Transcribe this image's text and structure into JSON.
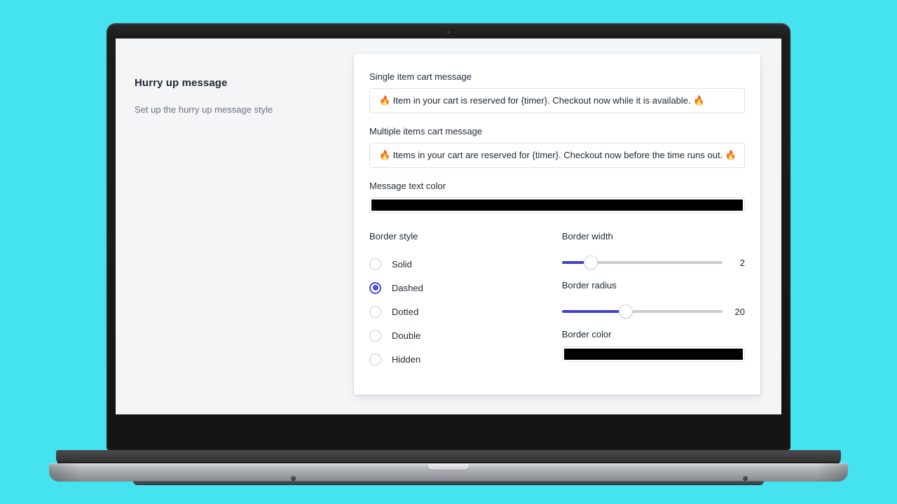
{
  "background_color": "#45e2f0",
  "panel": {
    "title": "Hurry up message",
    "subtitle": "Set up the hurry up message style"
  },
  "form": {
    "single_item": {
      "label": "Single item cart message",
      "value": "🔥 Item in your cart is reserved for {timer}. Checkout now while it is available. 🔥"
    },
    "multiple_items": {
      "label": "Multiple items cart message",
      "value": "🔥 Items in your cart are reserved for {timer}. Checkout now before the time runs out. 🔥"
    },
    "message_text_color": {
      "label": "Message text color",
      "value": "#000000"
    },
    "border_style": {
      "label": "Border style",
      "selected": "Dashed",
      "options": [
        {
          "label": "Solid",
          "selected": false
        },
        {
          "label": "Dashed",
          "selected": true
        },
        {
          "label": "Dotted",
          "selected": false
        },
        {
          "label": "Double",
          "selected": false
        },
        {
          "label": "Hidden",
          "selected": false
        }
      ]
    },
    "border_width": {
      "label": "Border width",
      "value": "2",
      "percent": 18
    },
    "border_radius": {
      "label": "Border radius",
      "value": "20",
      "percent": 40
    },
    "border_color": {
      "label": "Border color",
      "value": "#000000"
    }
  },
  "theme": {
    "accent": "#4b4dd6",
    "slider_fill": "#4040cf",
    "slider_track": "#c7cdd4",
    "text_primary": "#1f2633",
    "text_muted": "#6b7381",
    "page_bg": "#f4f5f7",
    "card_bg": "#ffffff"
  }
}
